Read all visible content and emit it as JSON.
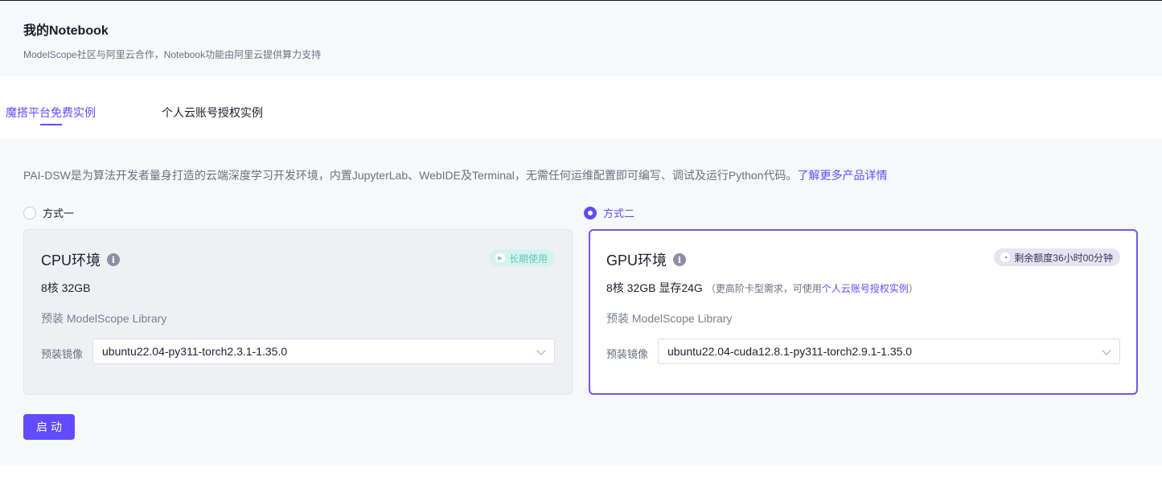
{
  "header": {
    "title": "我的Notebook",
    "subtitle": "ModelScope社区与阿里云合作，Notebook功能由阿里云提供算力支持"
  },
  "tabs": [
    {
      "label": "魔搭平台免费实例",
      "active": true
    },
    {
      "label": "个人云账号授权实例",
      "active": false
    }
  ],
  "description": {
    "text": "PAI-DSW是为算法开发者量身打造的云端深度学习开发环境，内置JupyterLab、WebIDE及Terminal，无需任何运维配置即可编写、调试及运行Python代码。",
    "link": "了解更多产品详情"
  },
  "options": [
    {
      "radio_label": "方式一",
      "selected": false,
      "card_title": "CPU环境",
      "info_icon": "info-icon",
      "badge_icon": "play-icon",
      "badge": "长期使用",
      "spec": "8核 32GB",
      "library": "预装 ModelScope Library",
      "image_label": "预装镜像",
      "image_value": "ubuntu22.04-py311-torch2.3.1-1.35.0"
    },
    {
      "radio_label": "方式二",
      "selected": true,
      "card_title": "GPU环境",
      "info_icon": "info-icon",
      "badge_icon": "clock-icon",
      "badge": "剩余额度36小时00分钟",
      "spec": "8核 32GB 显存24G",
      "spec_note_prefix": "（更高阶卡型需求，可使用",
      "spec_note_link": "个人云账号授权实例",
      "spec_note_suffix": "）",
      "library": "预装 ModelScope Library",
      "image_label": "预装镜像",
      "image_value": "ubuntu22.04-cuda12.8.1-py311-torch2.9.1-1.35.0"
    }
  ],
  "start_button": "启动",
  "colors": {
    "accent": "#624aff",
    "selected_border": "#7057e8",
    "badge_teal": "#5fc7bd",
    "background": "#f7f8fa"
  }
}
